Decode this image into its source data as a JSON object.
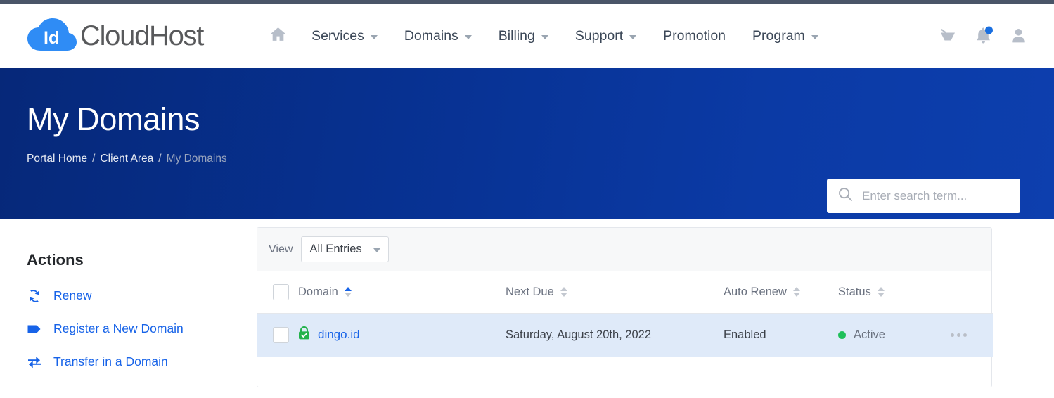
{
  "brand": {
    "logo_badge_text": "Id",
    "logo_text": "CloudHost",
    "logo_color": "#2f8cf5",
    "logo_text_color": "#58595b"
  },
  "header": {
    "nav": [
      {
        "label": "",
        "icon": "home-icon",
        "has_caret": false
      },
      {
        "label": "Services",
        "icon": "",
        "has_caret": true
      },
      {
        "label": "Domains",
        "icon": "",
        "has_caret": true
      },
      {
        "label": "Billing",
        "icon": "",
        "has_caret": true
      },
      {
        "label": "Support",
        "icon": "",
        "has_caret": true
      },
      {
        "label": "Promotion",
        "icon": "",
        "has_caret": false
      },
      {
        "label": "Program",
        "icon": "",
        "has_caret": true
      }
    ],
    "icons": [
      {
        "name": "shopping-cart-icon"
      },
      {
        "name": "notifications-bell-icon",
        "has_badge": true,
        "badge_color": "#1a6fe0"
      },
      {
        "name": "user-account-icon"
      }
    ]
  },
  "hero": {
    "title": "My Domains",
    "breadcrumb": [
      {
        "label": "Portal Home",
        "current": false
      },
      {
        "label": "Client Area",
        "current": false
      },
      {
        "label": "My Domains",
        "current": true
      }
    ],
    "breadcrumb_separator": "/",
    "background_color": "#073191"
  },
  "search": {
    "icon": "search-icon",
    "placeholder": "Enter search term...",
    "value": ""
  },
  "sidebar": {
    "title": "Actions",
    "items": [
      {
        "label": "Renew",
        "icon": "sync-renew-icon"
      },
      {
        "label": "Register a New Domain",
        "icon": "tag-icon"
      },
      {
        "label": "Transfer in a Domain",
        "icon": "transfer-arrows-icon"
      }
    ],
    "link_color": "#1763e8"
  },
  "table": {
    "toolbar": {
      "view_label": "View",
      "view_selected": "All Entries",
      "view_options": [
        "All Entries"
      ]
    },
    "columns": [
      {
        "key": "checkbox",
        "label": "",
        "sortable": false
      },
      {
        "key": "domain",
        "label": "Domain",
        "sortable": true,
        "sort_active": "asc"
      },
      {
        "key": "next_due",
        "label": "Next Due",
        "sortable": true,
        "sort_active": ""
      },
      {
        "key": "auto_renew",
        "label": "Auto Renew",
        "sortable": true,
        "sort_active": ""
      },
      {
        "key": "status",
        "label": "Status",
        "sortable": true,
        "sort_active": ""
      },
      {
        "key": "actions",
        "label": "",
        "sortable": false
      }
    ],
    "rows": [
      {
        "selected": false,
        "highlighted": true,
        "secure_icon": "green-lock-icon",
        "domain": "dingo.id",
        "next_due": "Saturday, August 20th, 2022",
        "auto_renew": "Enabled",
        "status": "Active",
        "status_color": "#1fc05a",
        "actions_icon": "more-options-icon"
      }
    ]
  }
}
